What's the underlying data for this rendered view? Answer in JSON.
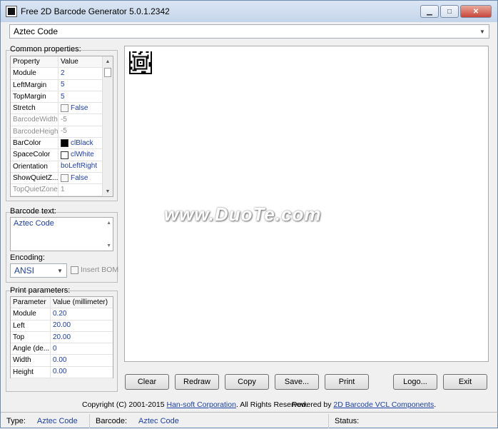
{
  "window": {
    "title": "Free 2D Barcode Generator 5.0.1.2342"
  },
  "symbology": {
    "selected": "Aztec Code"
  },
  "common_properties": {
    "label": "Common properties:",
    "headers": {
      "property": "Property",
      "value": "Value"
    },
    "rows": [
      {
        "name": "Module",
        "value": "2",
        "type": "text",
        "disabled": false
      },
      {
        "name": "LeftMargin",
        "value": "5",
        "type": "text",
        "disabled": false
      },
      {
        "name": "TopMargin",
        "value": "5",
        "type": "text",
        "disabled": false
      },
      {
        "name": "Stretch",
        "value": "False",
        "type": "check",
        "disabled": false
      },
      {
        "name": "BarcodeWidth",
        "value": "-5",
        "type": "text",
        "disabled": true
      },
      {
        "name": "BarcodeHeight",
        "value": "-5",
        "type": "text",
        "disabled": true
      },
      {
        "name": "BarColor",
        "value": "clBlack",
        "type": "color",
        "color": "#000000",
        "disabled": false
      },
      {
        "name": "SpaceColor",
        "value": "clWhite",
        "type": "color",
        "color": "#ffffff",
        "disabled": false
      },
      {
        "name": "Orientation",
        "value": "boLeftRight",
        "type": "text",
        "disabled": false
      },
      {
        "name": "ShowQuietZ...",
        "value": "False",
        "type": "check",
        "disabled": false
      },
      {
        "name": "TopQuietZone",
        "value": "1",
        "type": "text",
        "disabled": true
      }
    ]
  },
  "barcode_text": {
    "label": "Barcode text:",
    "value": "Aztec Code"
  },
  "encoding": {
    "label": "Encoding:",
    "value": "ANSI",
    "insert_bom": "Insert BOM"
  },
  "print_parameters": {
    "label": "Print parameters:",
    "headers": {
      "parameter": "Parameter",
      "value": "Value (millimeter)"
    },
    "rows": [
      {
        "name": "Module",
        "value": "0.20"
      },
      {
        "name": "Left",
        "value": "20.00"
      },
      {
        "name": "Top",
        "value": "20.00"
      },
      {
        "name": "Angle (de...",
        "value": "0"
      },
      {
        "name": "Width",
        "value": "0.00"
      },
      {
        "name": "Height",
        "value": "0.00"
      }
    ]
  },
  "watermark": "www.DuoTe.com",
  "buttons": {
    "clear": "Clear",
    "redraw": "Redraw",
    "copy": "Copy",
    "save": "Save...",
    "print": "Print",
    "logo": "Logo...",
    "exit": "Exit"
  },
  "footer": {
    "copyright": "Copyright (C) 2001-2015",
    "company": "Han-soft Corporation",
    "rights": ". All Rights Reserved.",
    "powered": "Powered by",
    "components": "2D Barcode VCL Components",
    "dot": "."
  },
  "status": {
    "type_label": "Type:",
    "type_value": "Aztec Code",
    "barcode_label": "Barcode:",
    "barcode_value": "Aztec Code",
    "status_label": "Status:"
  },
  "colors": {
    "accent_text": "#1e3ea8",
    "link": "#1b3fa5"
  }
}
